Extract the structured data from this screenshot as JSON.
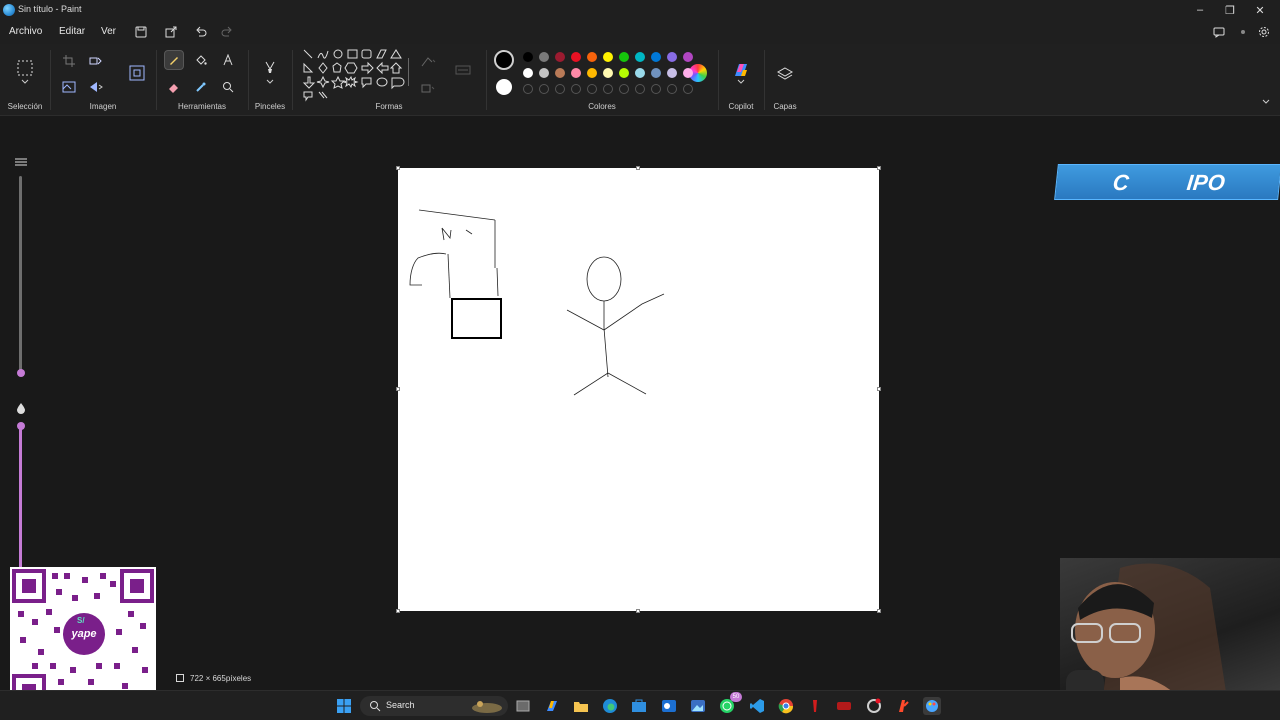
{
  "window": {
    "title": "Sin título - Paint",
    "minimize": "–",
    "maximize": "❐",
    "close": "✕"
  },
  "menu": {
    "archivo": "Archivo",
    "editar": "Editar",
    "ver": "Ver"
  },
  "ribbon": {
    "seleccion": "Selección",
    "imagen": "Imagen",
    "herramientas": "Herramientas",
    "pinceles": "Pinceles",
    "formas": "Formas",
    "colores": "Colores",
    "copilot": "Copilot",
    "capas": "Capas"
  },
  "colors": {
    "primary": "#000000",
    "secondary": "#ffffff",
    "palette_row1": [
      "#000000",
      "#7a7a7a",
      "#9b1b30",
      "#e81123",
      "#f7630c",
      "#fff100",
      "#16c60c",
      "#00b7c3",
      "#0078d7",
      "#886ce4",
      "#b146c2"
    ],
    "palette_row2": [
      "#ffffff",
      "#c3c3c3",
      "#b97a57",
      "#ff8aa8",
      "#ffb900",
      "#fff9b0",
      "#b6fc03",
      "#99d9ea",
      "#7092be",
      "#c8bfe7",
      "#ffaeea"
    ],
    "accent": "#c57bd6"
  },
  "status": {
    "canvas_size": "722 × 665píxeles"
  },
  "overlay": {
    "banner_left": "C",
    "banner_right": "IPO",
    "qr_label": "yape",
    "qr_badge": "S/"
  },
  "taskbar": {
    "search": "Search",
    "whatsapp_badge": "50"
  }
}
